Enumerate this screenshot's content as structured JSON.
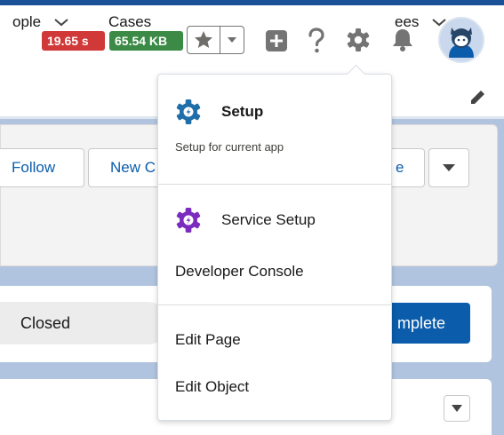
{
  "header": {
    "timing_badge": "19.65 s",
    "size_badge": "65.54 KB"
  },
  "nav": {
    "item_people": "ople",
    "item_cases": "Cases",
    "item_employees": "ees"
  },
  "highlights": {
    "follow_label": "Follow",
    "new_label": "New C",
    "right_button_label": "e"
  },
  "path": {
    "step_label": "Closed",
    "complete_label": "mplete"
  },
  "setup_menu": {
    "setup_title": "Setup",
    "setup_subtitle": "Setup for current app",
    "service_setup": "Service Setup",
    "developer_console": "Developer Console",
    "edit_page": "Edit Page",
    "edit_object": "Edit Object"
  },
  "colors": {
    "brand": "#0b5cab",
    "timing_badge_bg": "#d13838",
    "size_badge_bg": "#3b8a45",
    "setup_icon": "#1f6eaa",
    "service_setup_icon": "#7b2cbf"
  },
  "icons": {
    "favorite": "star-icon",
    "favorite_menu": "chevron-down-icon",
    "global_actions": "plus-icon",
    "help": "question-icon",
    "setup": "gear-icon",
    "notifications": "bell-icon",
    "avatar": "astro-avatar",
    "edit_nav": "pencil-icon"
  }
}
